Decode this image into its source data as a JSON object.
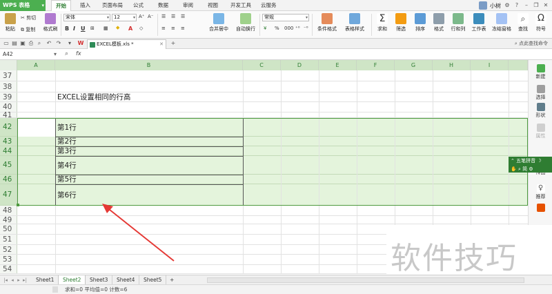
{
  "app": {
    "name": "WPS 表格"
  },
  "menus": [
    "开始",
    "插入",
    "页面布局",
    "公式",
    "数据",
    "审阅",
    "视图",
    "开发工具",
    "云服务"
  ],
  "active_menu": "开始",
  "user": {
    "name": "小树"
  },
  "ribbon": {
    "paste": "粘贴",
    "cut": "剪切",
    "copy": "复制",
    "format_painter": "格式刷",
    "font": "宋体",
    "size": "12",
    "number_format": "常规",
    "merge_center": "合并居中",
    "wrap_text": "自动换行",
    "cond_format": "条件格式",
    "table_style": "表格样式",
    "sum": "求和",
    "filter": "筛选",
    "sort": "排序",
    "format": "格式",
    "row_col": "行和列",
    "worksheet": "工作表",
    "freeze": "冻结窗格",
    "find": "查找",
    "symbol": "符号",
    "percent": "%",
    "thousands": "000"
  },
  "document": {
    "tab_title": "EXCEL模板.xls *"
  },
  "search_hint": "点此查找命令",
  "formula_bar": {
    "name_box": "A42",
    "fx": "fx"
  },
  "columns": [
    "A",
    "B",
    "C",
    "D",
    "E",
    "F",
    "G",
    "H",
    "I"
  ],
  "rows": [
    {
      "num": "37",
      "text": ""
    },
    {
      "num": "38",
      "text": ""
    },
    {
      "num": "39",
      "text": "EXCEL设置相同的行高"
    },
    {
      "num": "40",
      "text": ""
    },
    {
      "num": "41",
      "text": ""
    },
    {
      "num": "42",
      "text": "第1行"
    },
    {
      "num": "43",
      "text": "第2行"
    },
    {
      "num": "44",
      "text": "第3行"
    },
    {
      "num": "45",
      "text": "第4行"
    },
    {
      "num": "46",
      "text": "第5行"
    },
    {
      "num": "47",
      "text": "第6行"
    },
    {
      "num": "48",
      "text": ""
    },
    {
      "num": "49",
      "text": ""
    },
    {
      "num": "50",
      "text": ""
    },
    {
      "num": "51",
      "text": ""
    },
    {
      "num": "52",
      "text": ""
    },
    {
      "num": "53",
      "text": ""
    },
    {
      "num": "54",
      "text": ""
    }
  ],
  "side_panel": [
    "新建",
    "选择",
    "形状",
    "属性",
    "传图",
    "推荐"
  ],
  "ime": {
    "name": "五笔拼音",
    "mode": "简"
  },
  "sheets": [
    "Sheet1",
    "Sheet2",
    "Sheet3",
    "Sheet4",
    "Sheet5"
  ],
  "active_sheet": "Sheet2",
  "add_sheet": "+",
  "status": "求和=0  平均值=0  计数=6",
  "watermark": "软件技巧",
  "colors": {
    "accent": "#4caf50",
    "selection": "#e4f4dc",
    "arrow": "#e53935"
  }
}
